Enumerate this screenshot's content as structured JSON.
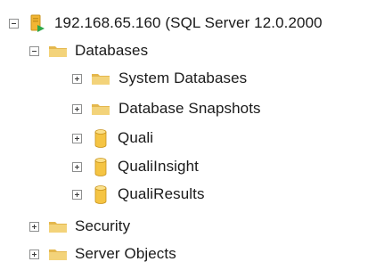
{
  "tree": {
    "server": {
      "label": "192.168.65.160 (SQL Server 12.0.2000",
      "icon": "server-icon",
      "expanded": true
    },
    "databases": {
      "label": "Databases",
      "icon": "folder-icon",
      "expanded": true
    },
    "system_databases": {
      "label": "System Databases",
      "icon": "folder-icon",
      "expanded": false
    },
    "database_snapshots": {
      "label": "Database Snapshots",
      "icon": "folder-icon",
      "expanded": false
    },
    "quali": {
      "label": "Quali",
      "icon": "database-icon",
      "expanded": false
    },
    "quali_insight": {
      "label": "QualiInsight",
      "icon": "database-icon",
      "expanded": false
    },
    "quali_results": {
      "label": "QualiResults",
      "icon": "database-icon",
      "expanded": false
    },
    "security": {
      "label": "Security",
      "icon": "folder-icon",
      "expanded": false
    },
    "server_objects": {
      "label": "Server Objects",
      "icon": "folder-icon",
      "expanded": false
    }
  },
  "colors": {
    "folder_front": "#f3d37a",
    "folder_back": "#e4b74d",
    "database_body": "#f5c443",
    "database_edge": "#c8931c",
    "server_body": "#f2b533",
    "server_badge": "#2ea84a",
    "toggle_border": "#8e8f8f"
  }
}
